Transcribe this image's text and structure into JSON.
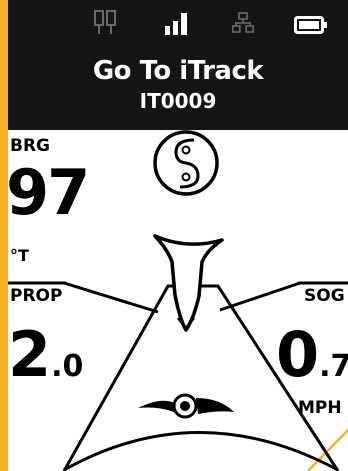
{
  "status_icons": [
    "instrument-bars-icon",
    "signal-strength-icon",
    "network-icon",
    "battery-icon"
  ],
  "header": {
    "title": "Go To iTrack",
    "subtitle": "IT0009"
  },
  "autopilot_mode_icon": "autopilot-s-icon",
  "bearing": {
    "label": "BRG",
    "value": "97",
    "unit": "°T"
  },
  "prop": {
    "label": "PROP",
    "value": "2",
    "decimal": ".0"
  },
  "sog": {
    "label": "SOG",
    "value": "0",
    "decimal": ".7",
    "unit": "MPH"
  },
  "colors": {
    "accent": "#f4b226",
    "header_bg": "#151515",
    "panel_bg": "#ffffff"
  }
}
